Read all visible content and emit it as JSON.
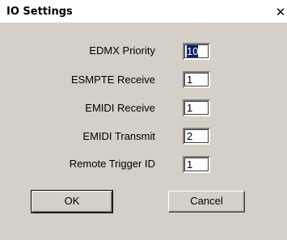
{
  "window": {
    "title": "IO Settings",
    "close_glyph": "✕"
  },
  "fields": [
    {
      "label": "EDMX Priority",
      "value": "10"
    },
    {
      "label": "ESMPTE Receive",
      "value": "1"
    },
    {
      "label": "EMIDI Receive",
      "value": "1"
    },
    {
      "label": "EMIDI Transmit",
      "value": "2"
    },
    {
      "label": "Remote Trigger ID",
      "value": "1"
    }
  ],
  "buttons": {
    "ok_label": "OK",
    "cancel_label": "Cancel"
  }
}
